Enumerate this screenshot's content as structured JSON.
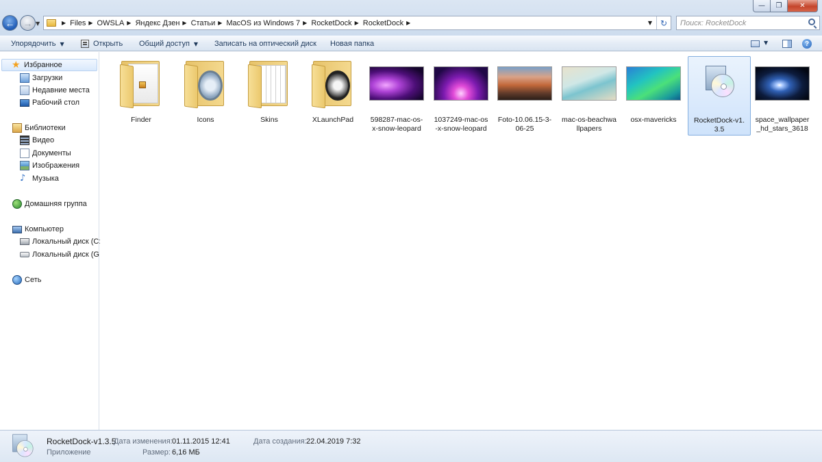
{
  "window": {
    "minimize_glyph": "—",
    "maximize_glyph": "❐",
    "close_glyph": "✕"
  },
  "nav_buttons": {
    "back_glyph": "←",
    "forward_glyph": "→"
  },
  "address": {
    "breadcrumbs": [
      "Files",
      "OWSLA",
      "Яндекс Дзен",
      "Статьи",
      "MacOS из Windows 7",
      "RocketDock",
      "RocketDock"
    ],
    "refresh_glyph": "↻"
  },
  "search": {
    "placeholder": "Поиск: RocketDock"
  },
  "toolbar": {
    "organize_label": "Упорядочить",
    "open_label": "Открыть",
    "share_label": "Общий доступ",
    "burn_label": "Записать на оптический диск",
    "new_folder_label": "Новая папка",
    "help_glyph": "?"
  },
  "sidebar": {
    "favorites": {
      "label": "Избранное",
      "items": [
        {
          "label": "Загрузки",
          "icon": "downloads-icon"
        },
        {
          "label": "Недавние места",
          "icon": "recent-places-icon"
        },
        {
          "label": "Рабочий стол",
          "icon": "desktop-icon"
        }
      ]
    },
    "libraries": {
      "label": "Библиотеки",
      "items": [
        {
          "label": "Видео",
          "icon": "video-icon"
        },
        {
          "label": "Документы",
          "icon": "documents-icon"
        },
        {
          "label": "Изображения",
          "icon": "images-icon"
        },
        {
          "label": "Музыка",
          "icon": "music-icon"
        }
      ]
    },
    "homegroup": {
      "label": "Домашняя группа"
    },
    "computer": {
      "label": "Компьютер",
      "items": [
        {
          "label": "Локальный диск (C:)",
          "icon": "local-disk-c-icon"
        },
        {
          "label": "Локальный диск (G:)",
          "icon": "local-disk-g-icon"
        }
      ]
    },
    "network": {
      "label": "Сеть"
    }
  },
  "files": [
    {
      "name": "Finder",
      "kind": "folder",
      "selected": false
    },
    {
      "name": "Icons",
      "kind": "folder",
      "selected": false
    },
    {
      "name": "Skins",
      "kind": "folder",
      "selected": false
    },
    {
      "name": "XLaunchPad",
      "kind": "folder",
      "selected": false
    },
    {
      "name": "598287-mac-os-x-snow-leopard",
      "kind": "image",
      "selected": false
    },
    {
      "name": "1037249-mac-os-x-snow-leopard",
      "kind": "image",
      "selected": false
    },
    {
      "name": "Foto-10.06.15-3-06-25",
      "kind": "image",
      "selected": false
    },
    {
      "name": "mac-os-beachwallpapers",
      "kind": "image",
      "selected": false
    },
    {
      "name": "osx-mavericks",
      "kind": "image",
      "selected": false
    },
    {
      "name": "RocketDock-v1.3.5",
      "kind": "application",
      "selected": true
    },
    {
      "name": "space_wallpaper_hd_stars_3618",
      "kind": "image",
      "selected": false
    }
  ],
  "details": {
    "name": "RocketDock-v1.3.5",
    "type": "Приложение",
    "modified_label": "Дата изменения:",
    "modified_value": "01.11.2015 12:41",
    "size_label": "Размер:",
    "size_value": "6,16 МБ",
    "created_label": "Дата создания:",
    "created_value": "22.04.2019 7:32"
  }
}
